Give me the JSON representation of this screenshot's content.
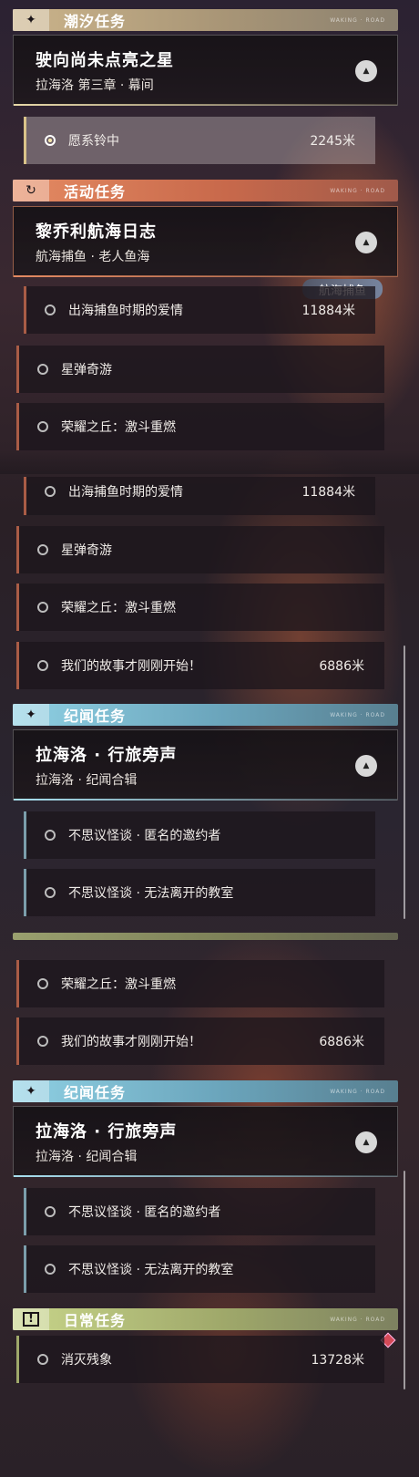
{
  "panels": [
    {
      "categories": [
        {
          "title": "潮汐任务",
          "icon": "✦",
          "icon_name": "sparkle-icon",
          "deco": "WAKING · ROAD",
          "main_quest": {
            "title": "驶向尚未点亮之星",
            "subtitle": "拉海洛 第三章 · 幕间"
          },
          "items": [
            {
              "label": "愿系铃中",
              "distance": "2245米",
              "active": true
            }
          ]
        },
        {
          "title": "活动任务",
          "icon": "↻",
          "icon_name": "cycle-icon",
          "deco": "WAKING · ROAD",
          "main_quest": {
            "title": "黎乔利航海日志",
            "subtitle": "航海捕鱼 · 老人鱼海"
          },
          "badge": "航海捕鱼",
          "items": [
            {
              "label": "出海捕鱼时期的爱情",
              "distance": "11884米"
            },
            {
              "label": "星弹奇游",
              "distance": ""
            },
            {
              "label": "荣耀之丘：激斗重燃",
              "distance": ""
            }
          ]
        }
      ]
    },
    {
      "items": [
        {
          "label": "出海捕鱼时期的爱情",
          "distance": "11884米"
        },
        {
          "label": "星弹奇游",
          "distance": ""
        },
        {
          "label": "荣耀之丘：激斗重燃",
          "distance": ""
        },
        {
          "label": "我们的故事才刚刚开始！",
          "distance": "6886米"
        }
      ],
      "category": {
        "title": "纪闻任务",
        "icon": "✦",
        "icon_name": "sparkle-icon",
        "deco": "WAKING · ROAD",
        "main_quest": {
          "title": "拉海洛 · 行旅旁声",
          "subtitle": "拉海洛 · 纪闻合辑"
        },
        "items": [
          {
            "label": "不思议怪谈 · 匿名的邀约者",
            "distance": ""
          },
          {
            "label": "不思议怪谈 · 无法离开的教室",
            "distance": ""
          }
        ]
      }
    },
    {
      "items": [
        {
          "label": "荣耀之丘：激斗重燃",
          "distance": ""
        },
        {
          "label": "我们的故事才刚刚开始！",
          "distance": "6886米"
        }
      ],
      "lore": {
        "title": "纪闻任务",
        "icon": "✦",
        "icon_name": "sparkle-icon",
        "deco": "WAKING · ROAD",
        "main_quest": {
          "title": "拉海洛 · 行旅旁声",
          "subtitle": "拉海洛 · 纪闻合辑"
        },
        "items": [
          {
            "label": "不思议怪谈 · 匿名的邀约者",
            "distance": ""
          },
          {
            "label": "不思议怪谈 · 无法离开的教室",
            "distance": ""
          }
        ]
      },
      "daily": {
        "title": "日常任务",
        "icon": "!",
        "icon_name": "alert-icon",
        "deco": "WAKING · ROAD",
        "items": [
          {
            "label": "消灭残象",
            "distance": "13728米"
          }
        ]
      }
    }
  ],
  "colors": {
    "tide": "#cbb48b",
    "event": "#e48a62",
    "lore": "#8fd0e3",
    "daily": "#c8d58a",
    "marker": "#d44a57"
  }
}
